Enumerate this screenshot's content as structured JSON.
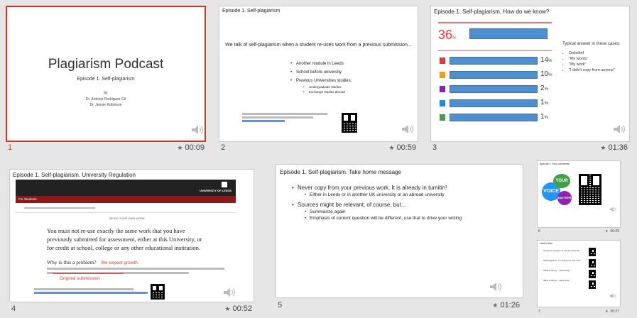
{
  "slides": [
    {
      "number": "1",
      "duration": "00:09",
      "title": "Plagiarism Podcast",
      "subtitle": "Episode 1. Self-plagiarism",
      "by": "by",
      "author1": "Dr. Antonio Rodriguez Gil",
      "author2": "Dr. Jennie Robinson"
    },
    {
      "number": "2",
      "duration": "00:59",
      "title": "Episode 1. Self-plagiarism",
      "lead": "We talk of self-plagiarism when a student re-uses work from a previous submission...",
      "items": [
        "Another module in Leeds",
        "School before university",
        "Previous Universities studies:"
      ],
      "subitems": [
        "Undergraduate studies",
        "Exchange studies abroad"
      ]
    },
    {
      "number": "3",
      "duration": "01:36",
      "title": "Episode 1. Self-plagiarism. How do we know?",
      "percent": "36",
      "percent_sign": "%",
      "rows": [
        {
          "label": "14",
          "unit": "%",
          "color": "#e53935",
          "value": 14
        },
        {
          "label": "10",
          "unit": "%",
          "color": "#f39c12",
          "value": 10
        },
        {
          "label": "2",
          "unit": "%",
          "color": "#8e24aa",
          "value": 2
        },
        {
          "label": "1",
          "unit": "%",
          "color": "#1e88e5",
          "value": 1
        },
        {
          "label": "1",
          "unit": "%",
          "color": "#43a047",
          "value": 1
        }
      ],
      "answers_heading": "Typical answer in these cases:",
      "answers": [
        "Disbelief",
        "\"My words\"",
        "\"My work\"",
        "\"I didn't copy from anyone\""
      ]
    },
    {
      "number": "4",
      "duration": "00:52",
      "title": "Episode 1. Self-plagiarism. University Regulation",
      "banner": "UNIVERSITY OF LEEDS",
      "nav": "For Students",
      "heading": "BEING YOUR OWN WORK",
      "body": "You must not re-use exactly the same work that you have previously submitted for assessment, either at this University, or for credit at school, college or any other educational institution.",
      "why": "Why is this a problem?",
      "note1": "We expect growth",
      "note2": "Original submission"
    },
    {
      "number": "5",
      "duration": "01:26",
      "title": "Episode 1. Self-plagiarism. Take home message",
      "point1": "Never copy from your previous work. It is already in turnitin!",
      "point1_sub": "Either in Leeds or in another UK university or an abroad university",
      "point2": "Sources might be relevant, of course, but...",
      "point2_subs": [
        "Summarize again",
        "Emphasis of current question will be different, use that to drive your writing"
      ]
    },
    {
      "number": "6",
      "duration": "00:25",
      "title": "Episode 1. Your comments",
      "bubble1": "YOUR",
      "bubble2": "VOICE",
      "bubble3": "MATTERS"
    },
    {
      "number": "7",
      "duration": "00:27",
      "title": "Useful links",
      "links": [
        "Academic Integrity at Leeds University",
        "Self-Plagiarism or reusing my own work",
        "Skills at library - referencing",
        "Skills at library - referencing"
      ]
    }
  ]
}
